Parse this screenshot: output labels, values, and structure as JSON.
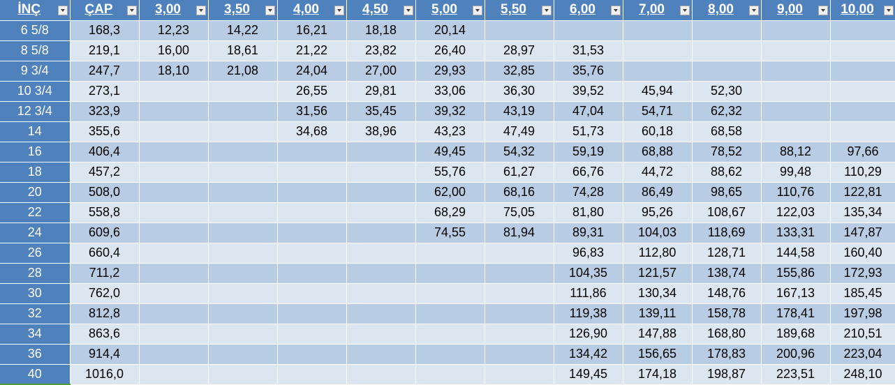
{
  "headers": [
    "İNÇ",
    "ÇAP",
    "3,00",
    "3,50",
    "4,00",
    "4,50",
    "5,00",
    "5,50",
    "6,00",
    "7,00",
    "8,00",
    "9,00",
    "10,00"
  ],
  "rows": [
    [
      "6 5/8",
      "168,3",
      "12,23",
      "14,22",
      "16,21",
      "18,18",
      "20,14",
      "",
      "",
      "",
      "",
      "",
      ""
    ],
    [
      "8 5/8",
      "219,1",
      "16,00",
      "18,61",
      "21,22",
      "23,82",
      "26,40",
      "28,97",
      "31,53",
      "",
      "",
      "",
      ""
    ],
    [
      "9 3/4",
      "247,7",
      "18,10",
      "21,08",
      "24,04",
      "27,00",
      "29,93",
      "32,85",
      "35,76",
      "",
      "",
      "",
      ""
    ],
    [
      "10 3/4",
      "273,1",
      "",
      "",
      "26,55",
      "29,81",
      "33,06",
      "36,30",
      "39,52",
      "45,94",
      "52,30",
      "",
      ""
    ],
    [
      "12 3/4",
      "323,9",
      "",
      "",
      "31,56",
      "35,45",
      "39,32",
      "43,19",
      "47,04",
      "54,71",
      "62,32",
      "",
      ""
    ],
    [
      "14",
      "355,6",
      "",
      "",
      "34,68",
      "38,96",
      "43,23",
      "47,49",
      "51,73",
      "60,18",
      "68,58",
      "",
      ""
    ],
    [
      "16",
      "406,4",
      "",
      "",
      "",
      "",
      "49,45",
      "54,32",
      "59,19",
      "68,88",
      "78,52",
      "88,12",
      "97,66"
    ],
    [
      "18",
      "457,2",
      "",
      "",
      "",
      "",
      "55,76",
      "61,27",
      "66,76",
      "44,72",
      "88,62",
      "99,48",
      "110,29"
    ],
    [
      "20",
      "508,0",
      "",
      "",
      "",
      "",
      "62,00",
      "68,16",
      "74,28",
      "86,49",
      "98,65",
      "110,76",
      "122,81"
    ],
    [
      "22",
      "558,8",
      "",
      "",
      "",
      "",
      "68,29",
      "75,05",
      "81,80",
      "95,26",
      "108,67",
      "122,03",
      "135,34"
    ],
    [
      "24",
      "609,6",
      "",
      "",
      "",
      "",
      "74,55",
      "81,94",
      "89,31",
      "104,03",
      "118,69",
      "133,31",
      "147,87"
    ],
    [
      "26",
      "660,4",
      "",
      "",
      "",
      "",
      "",
      "",
      "96,83",
      "112,80",
      "128,71",
      "144,58",
      "160,40"
    ],
    [
      "28",
      "711,2",
      "",
      "",
      "",
      "",
      "",
      "",
      "104,35",
      "121,57",
      "138,74",
      "155,86",
      "172,93"
    ],
    [
      "30",
      "762,0",
      "",
      "",
      "",
      "",
      "",
      "",
      "111,86",
      "130,34",
      "148,76",
      "167,13",
      "185,45"
    ],
    [
      "32",
      "812,8",
      "",
      "",
      "",
      "",
      "",
      "",
      "119,38",
      "139,11",
      "158,78",
      "178,41",
      "197,98"
    ],
    [
      "34",
      "863,6",
      "",
      "",
      "",
      "",
      "",
      "",
      "126,90",
      "147,88",
      "168,80",
      "189,68",
      "210,51"
    ],
    [
      "36",
      "914,4",
      "",
      "",
      "",
      "",
      "",
      "",
      "134,42",
      "156,65",
      "178,83",
      "200,96",
      "223,04"
    ],
    [
      "40",
      "1016,0",
      "",
      "",
      "",
      "",
      "",
      "",
      "149,45",
      "174,18",
      "198,87",
      "223,51",
      "248,10"
    ]
  ],
  "colors": {
    "header_bg": "#4f81bd",
    "row_dark": "#b8cce4",
    "row_light": "#dce6f1"
  }
}
